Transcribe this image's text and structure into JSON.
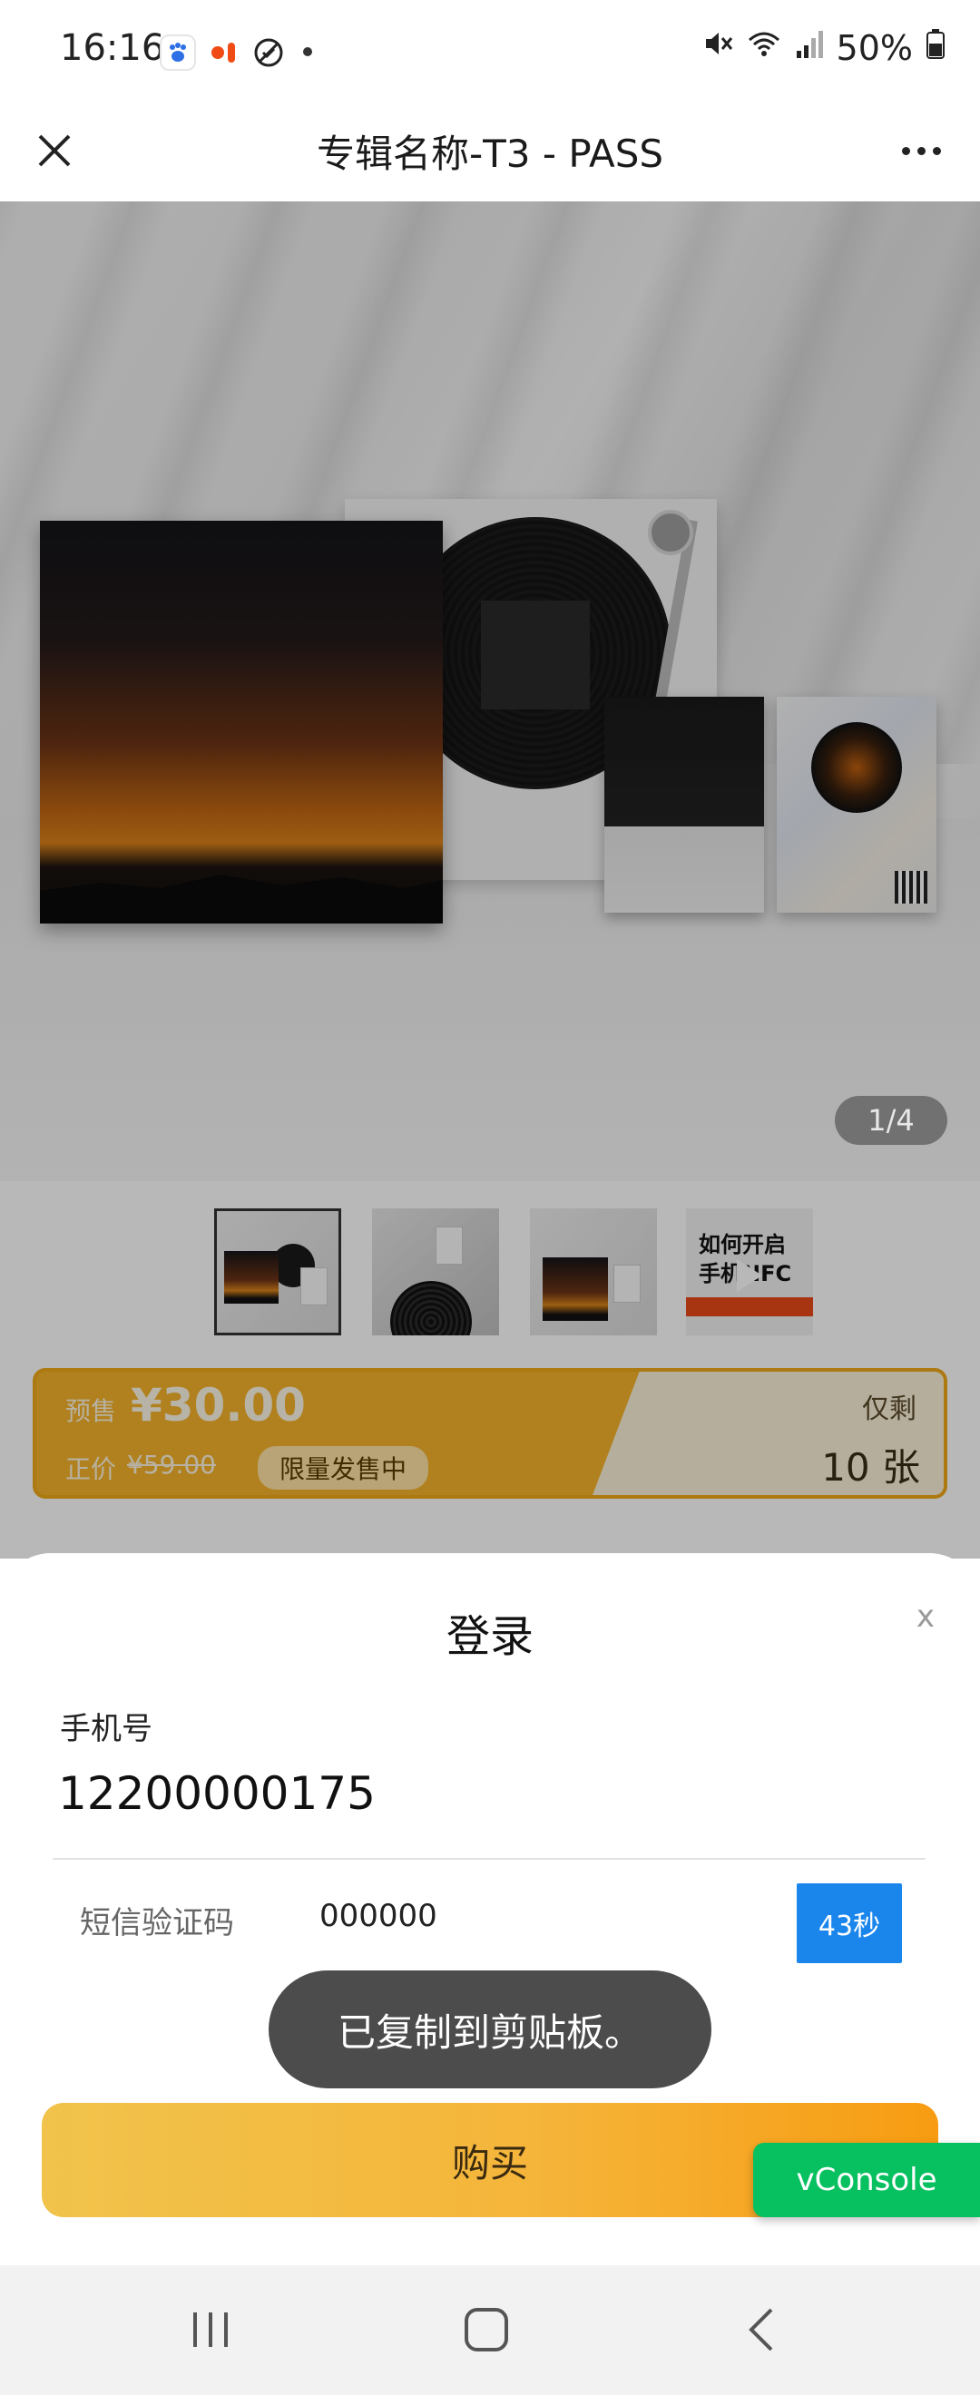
{
  "status_bar": {
    "time": "16:16",
    "battery": "50%",
    "app_icons": [
      "baidu-icon",
      "red-app-icon",
      "blocked-icon"
    ]
  },
  "title_bar": {
    "title": "专辑名称-T3 - PASS"
  },
  "product": {
    "image_counter": "1/4",
    "thumbnail_4_text": "如何开启\n手机NFC"
  },
  "price": {
    "presale_label": "预售",
    "presale_price": "¥30.00",
    "original_label": "正价",
    "original_price": "¥59.00",
    "limited_badge": "限量发售中",
    "remaining_label": "仅剩",
    "remaining_count": "10 张"
  },
  "login_modal": {
    "title": "登录",
    "close": "x",
    "phone_label": "手机号",
    "phone_value": "12200000175",
    "sms_label": "短信验证码",
    "sms_value": "000000",
    "countdown": "43秒",
    "buy_button": "购买"
  },
  "toast": {
    "message": "已复制到剪贴板。"
  },
  "vconsole": {
    "label": "vConsole"
  },
  "colors": {
    "accent_yellow": "#f4b32a",
    "countdown_blue": "#1a86ec",
    "vconsole_green": "#07c160"
  }
}
